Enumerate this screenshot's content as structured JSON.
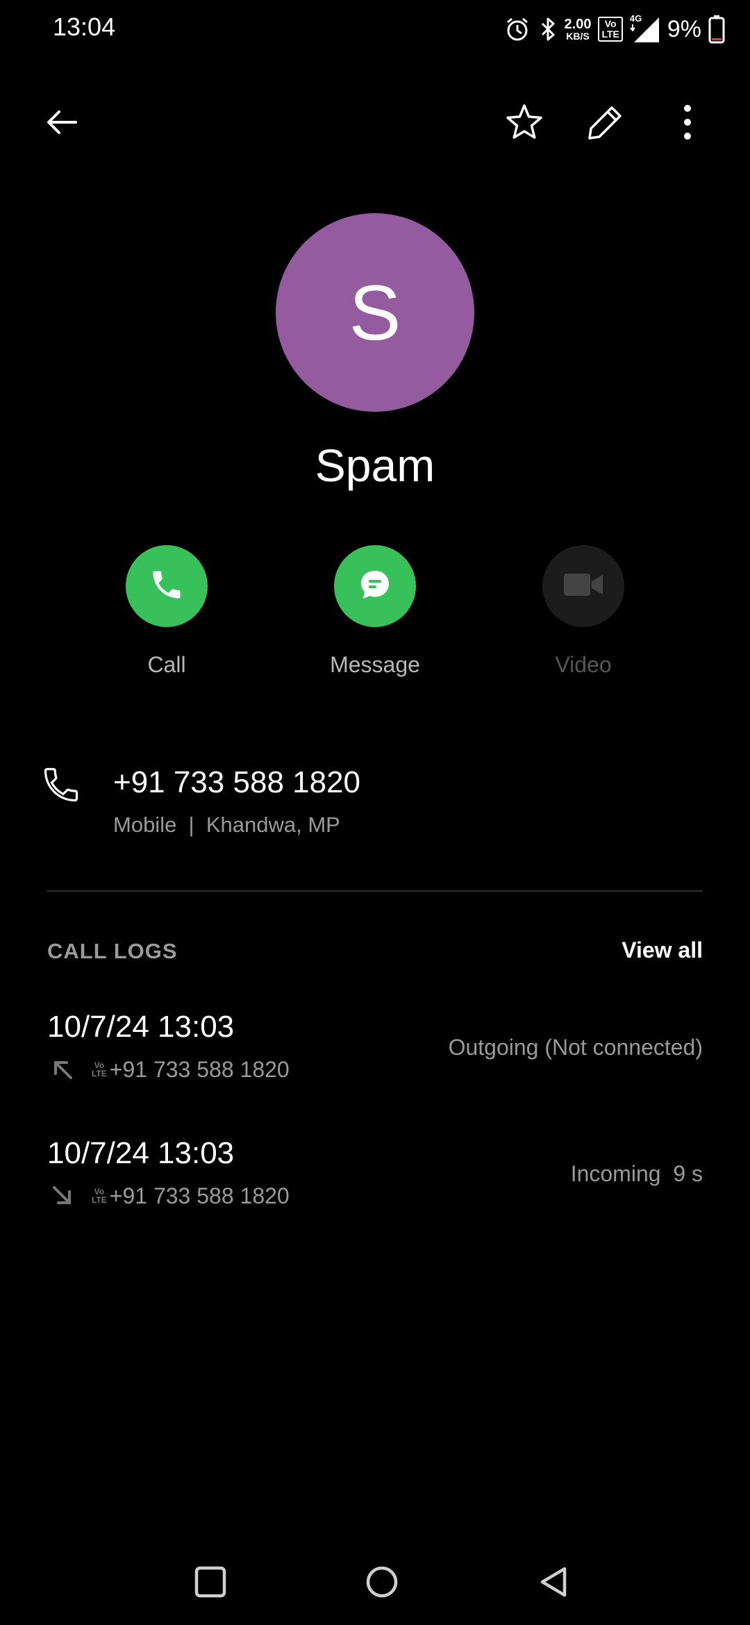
{
  "status_bar": {
    "time": "13:04",
    "net_speed_value": "2.00",
    "net_speed_unit": "KB/S",
    "volte_top": "Vo",
    "volte_bottom": "LTE",
    "network_type": "4G",
    "battery_percent": "9%",
    "icons": [
      "alarm-icon",
      "bluetooth-icon",
      "signal-icon",
      "battery-icon"
    ]
  },
  "app_bar": {
    "icons": [
      "back-arrow-icon",
      "star-icon",
      "pencil-icon",
      "more-vert-icon"
    ]
  },
  "contact": {
    "initial": "S",
    "name": "Spam",
    "avatar_color": "#945c9e"
  },
  "actions": {
    "call_label": "Call",
    "message_label": "Message",
    "video_label": "Video",
    "accent_color": "#38c05a"
  },
  "phone": {
    "number": "+91 733 588 1820",
    "meta": "Mobile  |  Khandwa, MP"
  },
  "call_logs": {
    "title": "CALL LOGS",
    "view_all": "View all",
    "entries": [
      {
        "datetime": "10/7/24 13:03",
        "number": "+91 733 588 1820",
        "status": "Outgoing (Not connected)",
        "direction": "outgoing",
        "volte_top": "Vo",
        "volte_bottom": "LTE"
      },
      {
        "datetime": "10/7/24 13:03",
        "number": "+91 733 588 1820",
        "status": "Incoming  9 s",
        "direction": "incoming",
        "volte_top": "Vo",
        "volte_bottom": "LTE"
      }
    ]
  },
  "nav_bar": {
    "icons": [
      "recents-square-icon",
      "home-circle-icon",
      "back-triangle-icon"
    ]
  }
}
